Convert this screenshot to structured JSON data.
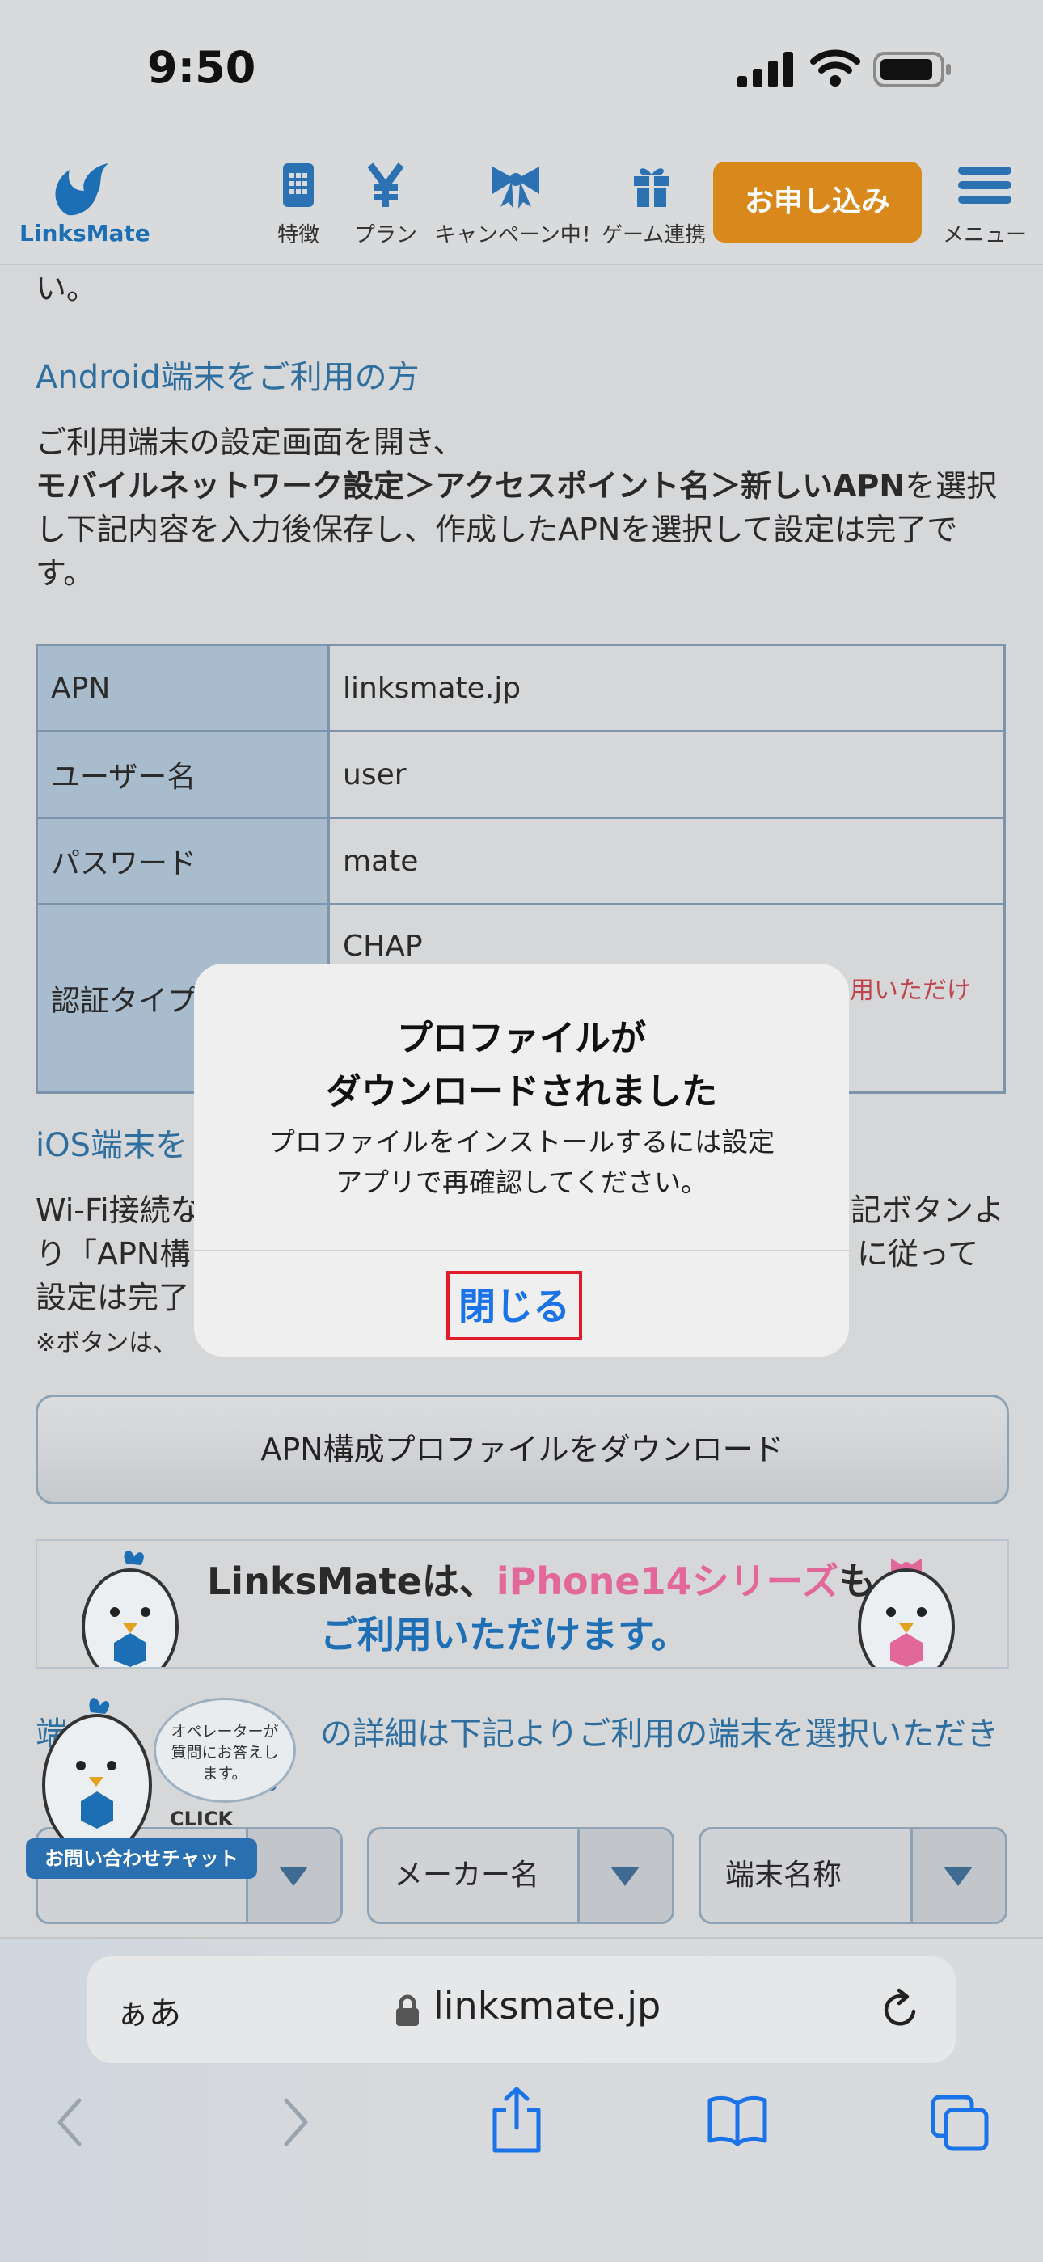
{
  "status_bar": {
    "time": "9:50"
  },
  "header": {
    "logo_text": "LinksMate",
    "nav": [
      {
        "label": "特徴",
        "icon": "phone-icon"
      },
      {
        "label": "プラン",
        "icon": "yen-icon"
      },
      {
        "label": "キャンペーン中！",
        "icon": "ribbon-icon"
      },
      {
        "label": "ゲーム連携",
        "icon": "gift-icon"
      }
    ],
    "apply_label": "お申し込み",
    "menu_label": "メニュー"
  },
  "content": {
    "fragment": "い。",
    "android_heading": "Android端末をご利用の方",
    "android_text_1": "ご利用端末の設定画面を開き、",
    "android_text_bold": "モバイルネットワーク設定＞アクセスポイント名＞新しいAPN",
    "android_text_2": "を選択し下記内容を入力後保存し、作成したAPNを選択して設定は完了です。",
    "table": [
      {
        "key": "APN",
        "value": "linksmate.jp"
      },
      {
        "key": "ユーザー名",
        "value": "user"
      },
      {
        "key": "パスワード",
        "value": "mate"
      },
      {
        "key": "認証タイプ",
        "value": "CHAP",
        "note": "用いただけ"
      }
    ],
    "ios_heading": "iOS端末を",
    "ios_text_a": "Wi-Fi接続な",
    "ios_text_a_end": "記ボタンよ",
    "ios_text_b": "り「APN構",
    "ios_text_b_end": "に従って",
    "ios_text_c": "設定は完了",
    "ios_note": "※ボタンは、",
    "download_button": "APN構成プロファイルをダウンロード",
    "banner": {
      "brand": "LinksMateは、",
      "highlight": "iPhone14シリーズ",
      "end": "も",
      "line2": "ご利用いただけます。"
    },
    "device_text_1": "端",
    "device_text_2": "の詳細は下記よりご利用の端末を選択いただき",
    "device_text_3": "。",
    "selects": [
      "",
      "メーカー名",
      "端末名称"
    ]
  },
  "chat_widget": {
    "bubble": "オペレーターが質問にお答えします。",
    "click": "CLICK",
    "label": "お問い合わせチャット"
  },
  "dialog": {
    "title_line1": "プロファイルが",
    "title_line2": "ダウンロードされました",
    "message_line1": "プロファイルをインストールするには設定",
    "message_line2": "アプリで再確認してください。",
    "close_label": "閉じる"
  },
  "browser": {
    "aa_label": "ぁあ",
    "url": "linksmate.jp"
  }
}
